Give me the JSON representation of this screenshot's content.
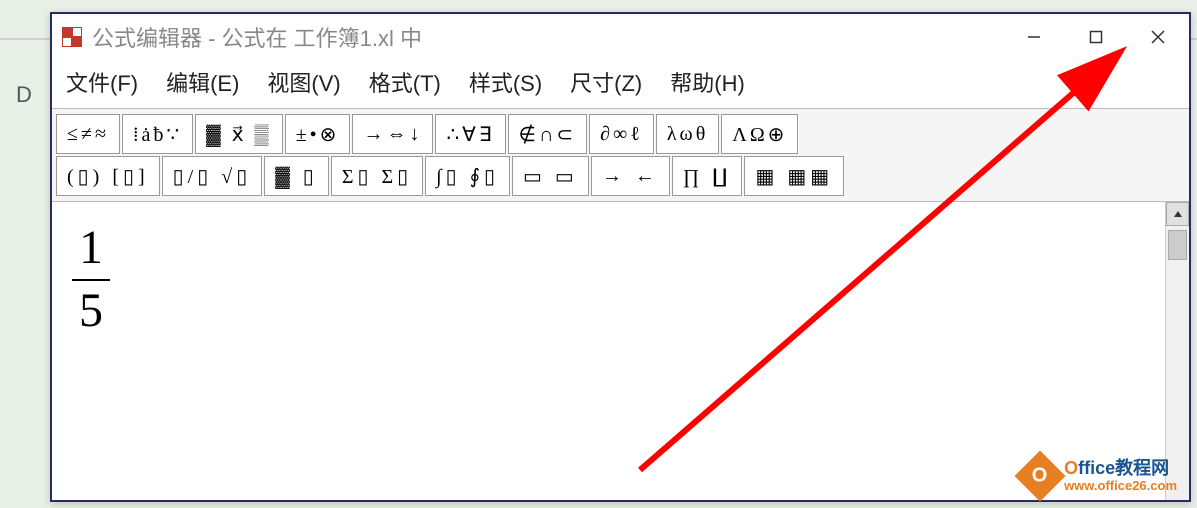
{
  "background": {
    "column_label": "D"
  },
  "window": {
    "title": "公式编辑器 - 公式在 工作簿1.xl 中",
    "controls": {
      "minimize": "minimize",
      "maximize": "maximize",
      "close": "close"
    }
  },
  "menubar": {
    "items": [
      {
        "label": "文件(F)"
      },
      {
        "label": "编辑(E)"
      },
      {
        "label": "视图(V)"
      },
      {
        "label": "格式(T)"
      },
      {
        "label": "样式(S)"
      },
      {
        "label": "尺寸(Z)"
      },
      {
        "label": "帮助(H)"
      }
    ]
  },
  "toolbar": {
    "row1": [
      {
        "name": "relational-symbols",
        "glyphs": "≤≠≈"
      },
      {
        "name": "spaces-ellipses",
        "glyphs": "⁞ȧƀ∵"
      },
      {
        "name": "embellishments",
        "glyphs": "▓ x⃗ ▒"
      },
      {
        "name": "operator-symbols",
        "glyphs": "±•⊗"
      },
      {
        "name": "arrow-symbols",
        "glyphs": "→⇔↓"
      },
      {
        "name": "logical-symbols",
        "glyphs": "∴∀∃"
      },
      {
        "name": "set-theory-symbols",
        "glyphs": "∉∩⊂"
      },
      {
        "name": "misc-symbols",
        "glyphs": "∂∞ℓ"
      },
      {
        "name": "greek-lowercase",
        "glyphs": "λωθ"
      },
      {
        "name": "greek-uppercase",
        "glyphs": "ΛΩ⊕"
      }
    ],
    "row2": [
      {
        "name": "fence-templates",
        "glyphs": "(▯) [▯]"
      },
      {
        "name": "fraction-radical-templates",
        "glyphs": "▯/▯ √▯"
      },
      {
        "name": "subscript-superscript-templates",
        "glyphs": "▓ ▯"
      },
      {
        "name": "summation-templates",
        "glyphs": "Σ▯ Σ▯"
      },
      {
        "name": "integral-templates",
        "glyphs": "∫▯ ∮▯"
      },
      {
        "name": "bar-templates",
        "glyphs": "▭ ▭"
      },
      {
        "name": "arrow-templates",
        "glyphs": "→ ←"
      },
      {
        "name": "product-templates",
        "glyphs": "∏ ∐"
      },
      {
        "name": "matrix-templates",
        "glyphs": "▦ ▦▦"
      }
    ]
  },
  "canvas": {
    "fraction": {
      "numerator": "1",
      "denominator": "5"
    }
  },
  "annotation": {
    "type": "arrow",
    "color": "#ff0000",
    "target": "close-button"
  },
  "watermark": {
    "logo_letter": "O",
    "line1_highlight": "O",
    "line1_rest": "ffice教程网",
    "line2": "www.office26.com"
  }
}
